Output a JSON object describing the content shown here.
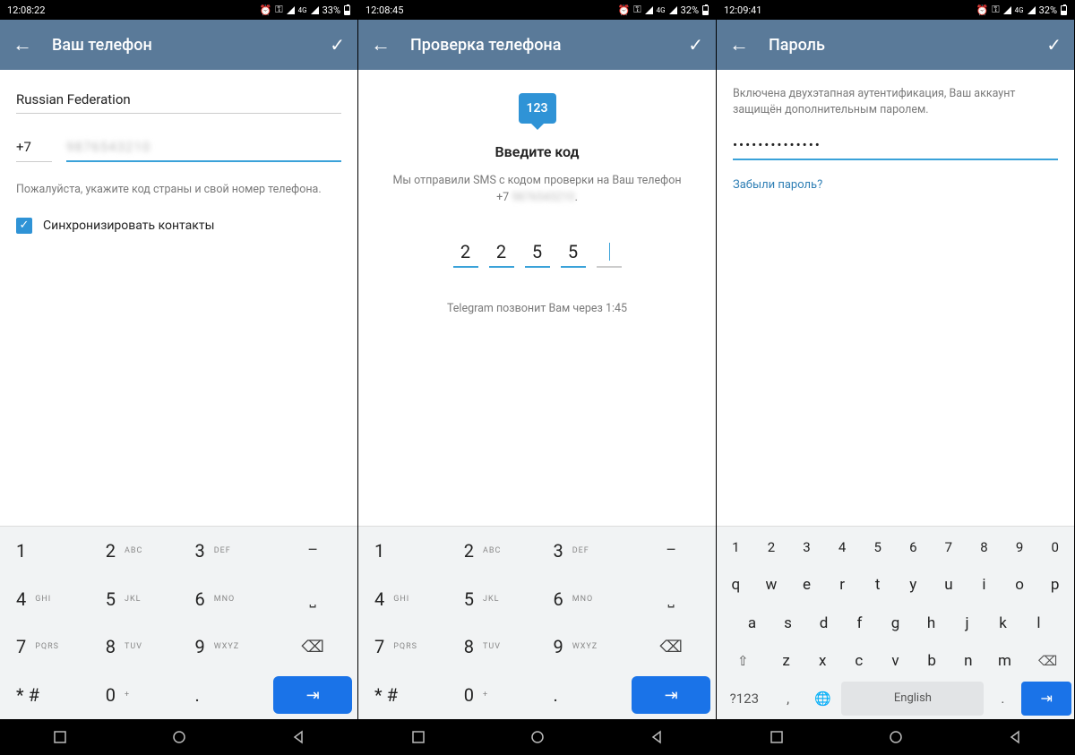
{
  "screens": [
    {
      "status": {
        "time": "12:08:22",
        "battery": "33%"
      },
      "title": "Ваш телефон",
      "country": "Russian Federation",
      "prefix": "+7",
      "phone_blur": "9876543210",
      "hint": "Пожалуйста, укажите код страны и свой номер телефона.",
      "sync_label": "Синхронизировать контакты"
    },
    {
      "status": {
        "time": "12:08:45",
        "battery": "32%"
      },
      "title": "Проверка телефона",
      "bubble": "123",
      "heading": "Введите код",
      "sms_line1": "Мы отправили SMS с кодом проверки на Ваш телефон",
      "sms_prefix": "+7",
      "sms_blur": "9876543210",
      "code": [
        "2",
        "2",
        "5",
        "5",
        ""
      ],
      "timer": "Telegram позвонит Вам через 1:45"
    },
    {
      "status": {
        "time": "12:09:41",
        "battery": "32%"
      },
      "title": "Пароль",
      "desc": "Включена двухэтапная аутентификация, Ваш аккаунт защищён дополнительным паролем.",
      "password_mask": "••••••••••••••",
      "forgot": "Забыли пароль?"
    }
  ],
  "keypad": {
    "keys": [
      {
        "n": "1",
        "s": ""
      },
      {
        "n": "2",
        "s": "ABC"
      },
      {
        "n": "3",
        "s": "DEF"
      },
      {
        "op": "–"
      },
      {
        "n": "4",
        "s": "GHI"
      },
      {
        "n": "5",
        "s": "JKL"
      },
      {
        "n": "6",
        "s": "MNO"
      },
      {
        "op": "␣"
      },
      {
        "n": "7",
        "s": "PQRS"
      },
      {
        "n": "8",
        "s": "TUV"
      },
      {
        "n": "9",
        "s": "WXYZ"
      },
      {
        "op": "⌫"
      },
      {
        "n": "* #",
        "s": ""
      },
      {
        "n": "0",
        "s": "+"
      },
      {
        "n": ".",
        "s": ""
      },
      {
        "enter": "⇥"
      }
    ]
  },
  "qwerty": {
    "row_nums": [
      "1",
      "2",
      "3",
      "4",
      "5",
      "6",
      "7",
      "8",
      "9",
      "0"
    ],
    "row1": [
      "q",
      "w",
      "e",
      "r",
      "t",
      "y",
      "u",
      "i",
      "o",
      "p"
    ],
    "row2": [
      "a",
      "s",
      "d",
      "f",
      "g",
      "h",
      "j",
      "k",
      "l"
    ],
    "row3": [
      "z",
      "x",
      "c",
      "v",
      "b",
      "n",
      "m"
    ],
    "shift": "⇧",
    "backspace": "⌫",
    "sym": "?123",
    "comma": ",",
    "globe": "🌐",
    "space": "English",
    "period": ".",
    "enter": "⇥"
  },
  "status_icons": {
    "key": "⚬━",
    "alarm": "⏰",
    "net": "4G"
  }
}
